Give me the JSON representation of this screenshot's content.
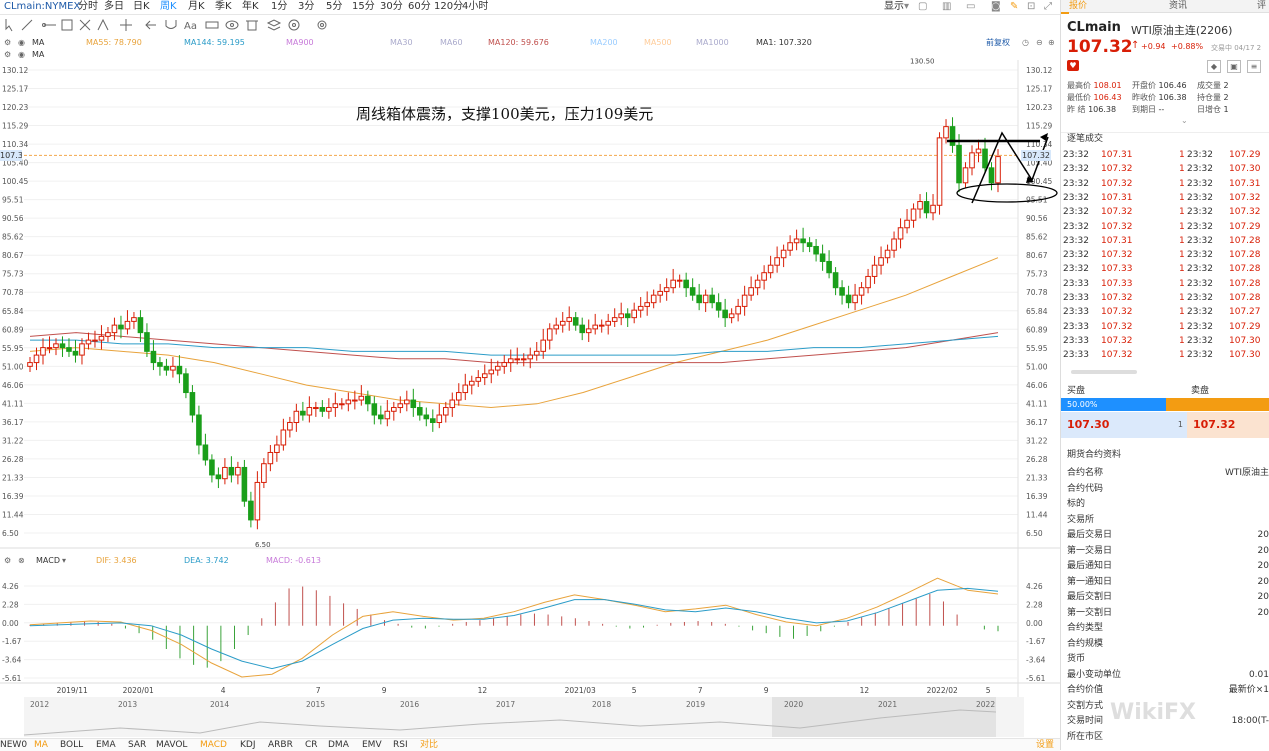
{
  "symbol_bar": {
    "symbol": "CLmain:NYMEX",
    "periods": [
      "分时",
      "多日",
      "日K",
      "周K",
      "月K",
      "季K",
      "年K",
      "1分",
      "3分",
      "5分",
      "15分",
      "30分",
      "60分",
      "120分",
      "4小时"
    ],
    "active_period": "周K",
    "display_label": "显示"
  },
  "ma_row": {
    "ma_label": "MA",
    "ma55": "MA55: 78.790",
    "ma144": "MA144: 59.195",
    "ma900": "MA900",
    "ma30": "MA30",
    "ma60": "MA60",
    "ma120": "MA120: 59.676",
    "ma200": "MA200",
    "ma500": "MA500",
    "ma1000": "MA1000",
    "ma1": "MA1: 107.320",
    "fuquan": "前复权",
    "ma_label2": "MA"
  },
  "annotation": "周线箱体震荡，支撑100美元，压力109美元",
  "price_axis": [
    "130.12",
    "125.17",
    "120.23",
    "115.29",
    "110.34",
    "105.40",
    "100.45",
    "95.51",
    "90.56",
    "85.62",
    "80.67",
    "75.73",
    "70.78",
    "65.84",
    "60.89",
    "55.95",
    "51.00",
    "46.06",
    "41.11",
    "36.17",
    "31.22",
    "26.28",
    "21.33",
    "16.39",
    "11.44",
    "6.50"
  ],
  "current_price_tag": "107.32",
  "high_label": "130.50",
  "low_label": "6.50",
  "macd_row": {
    "label": "MACD",
    "dif": "DIF: 3.436",
    "dea": "DEA: 3.742",
    "macd": "MACD: -0.613"
  },
  "macd_axis": [
    "4.26",
    "2.28",
    "0.00",
    "-1.67",
    "-3.64",
    "-5.61"
  ],
  "time_axis": [
    "2019/11",
    "2020/01",
    "4",
    "7",
    "9",
    "12",
    "2021/03",
    "5",
    "7",
    "9",
    "12",
    "2022/02",
    "5"
  ],
  "overview_years": [
    "2012",
    "2013",
    "2014",
    "2015",
    "2016",
    "2017",
    "2018",
    "2019",
    "2020",
    "2021",
    "2022"
  ],
  "indicator_tabs": [
    "NEW0",
    "MA",
    "BOLL",
    "EMA",
    "SAR",
    "MAVOL",
    "MACD",
    "KDJ",
    "ARBR",
    "CR",
    "DMA",
    "EMV",
    "RSI",
    "对比"
  ],
  "indicator_active": [
    "MA",
    "MACD",
    "对比"
  ],
  "settings_label": "设置",
  "right_panel": {
    "tabs": [
      "报价",
      "资讯",
      "评"
    ],
    "name": "CLmain",
    "full_name": "WTI原油主连(2206)",
    "price": "107.32",
    "change": "+0.94",
    "change_pct": "+0.88%",
    "trade_time": "交易中 04/17 2",
    "stats": [
      {
        "label": "最高价",
        "value": "108.01"
      },
      {
        "label": "开盘价",
        "value": "106.46"
      },
      {
        "label": "成交量",
        "value": "2"
      },
      {
        "label": "最低价",
        "value": "106.43"
      },
      {
        "label": "昨收价",
        "value": "106.38"
      },
      {
        "label": "持仓量",
        "value": "2"
      },
      {
        "label": "昨 结",
        "value": "106.38"
      },
      {
        "label": "到期日",
        "value": "--"
      },
      {
        "label": "日增仓",
        "value": "1"
      }
    ],
    "ticks_title": "逐笔成交",
    "ticks": [
      [
        "23:32",
        "107.31",
        "1",
        "23:32",
        "107.29"
      ],
      [
        "23:32",
        "107.32",
        "1",
        "23:32",
        "107.30"
      ],
      [
        "23:32",
        "107.32",
        "1",
        "23:32",
        "107.31"
      ],
      [
        "23:32",
        "107.31",
        "1",
        "23:32",
        "107.32"
      ],
      [
        "23:32",
        "107.32",
        "1",
        "23:32",
        "107.32"
      ],
      [
        "23:32",
        "107.32",
        "1",
        "23:32",
        "107.29"
      ],
      [
        "23:32",
        "107.31",
        "1",
        "23:32",
        "107.28"
      ],
      [
        "23:32",
        "107.32",
        "1",
        "23:32",
        "107.28"
      ],
      [
        "23:32",
        "107.33",
        "1",
        "23:32",
        "107.28"
      ],
      [
        "23:33",
        "107.33",
        "1",
        "23:32",
        "107.28"
      ],
      [
        "23:33",
        "107.32",
        "1",
        "23:32",
        "107.28"
      ],
      [
        "23:33",
        "107.32",
        "1",
        "23:32",
        "107.27"
      ],
      [
        "23:33",
        "107.32",
        "1",
        "23:32",
        "107.29"
      ],
      [
        "23:33",
        "107.32",
        "1",
        "23:32",
        "107.30"
      ],
      [
        "23:33",
        "107.32",
        "1",
        "23:32",
        "107.30"
      ]
    ],
    "buy_label": "买盘",
    "sell_label": "卖盘",
    "buy_ratio_text": "50.00%",
    "buy_ratio": 0.5,
    "bid_price": "107.30",
    "bid_qty": "1",
    "ask_price": "107.32",
    "info_title": "期货合约资料",
    "info": [
      {
        "label": "合约名称",
        "value": "WTI原油主"
      },
      {
        "label": "合约代码",
        "value": ""
      },
      {
        "label": "标的",
        "value": ""
      },
      {
        "label": "交易所",
        "value": ""
      },
      {
        "label": "最后交易日",
        "value": "20"
      },
      {
        "label": "第一交易日",
        "value": "20"
      },
      {
        "label": "最后通知日",
        "value": "20"
      },
      {
        "label": "第一通知日",
        "value": "20"
      },
      {
        "label": "最后交割日",
        "value": "20"
      },
      {
        "label": "第一交割日",
        "value": "20"
      },
      {
        "label": "合约类型",
        "value": ""
      },
      {
        "label": "合约规模",
        "value": ""
      },
      {
        "label": "货币",
        "value": ""
      },
      {
        "label": "最小变动单位",
        "value": "0.01"
      },
      {
        "label": "合约价值",
        "value": "最新价×1"
      },
      {
        "label": "交割方式",
        "value": ""
      },
      {
        "label": "交易时间",
        "value": "18:00(T-"
      },
      {
        "label": "所在市区",
        "value": ""
      }
    ]
  },
  "watermark": "WikiFX",
  "colors": {
    "up": "#d81e06",
    "down": "#1a9e1a",
    "ma55": "#e8a33c",
    "ma144": "#2b9cc8",
    "ma120": "#c0504d",
    "accent_blue": "#1e90ff"
  }
}
